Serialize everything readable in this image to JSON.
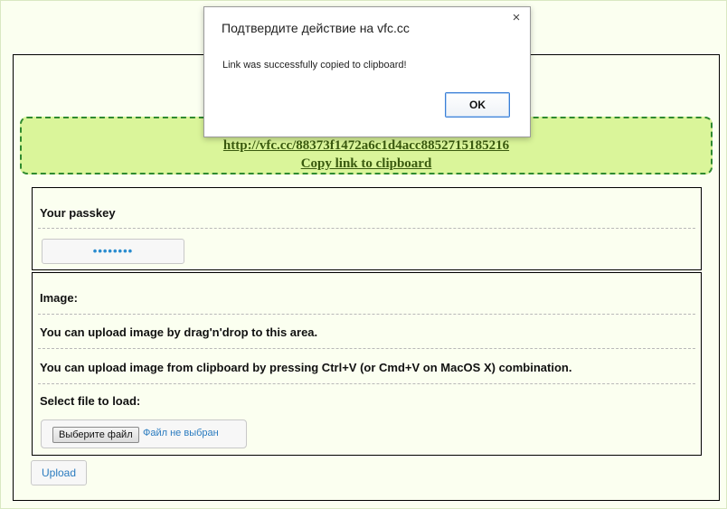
{
  "link_panel": {
    "url": "http://vfc.cc/88373f1472a6c1d4acc8852715185216",
    "copy_label": "Copy link to clipboard"
  },
  "passkey": {
    "label": "Your passkey",
    "value": "••••••••"
  },
  "image_section": {
    "label": "Image:",
    "drag_drop_text": "You can upload image by drag'n'drop to this area.",
    "clipboard_text": "You can upload image from clipboard by pressing Ctrl+V (or Cmd+V on MacOS X) combination.",
    "select_file_label": "Select file to load:",
    "choose_file_button": "Выберите файл",
    "file_status": "Файл не выбран"
  },
  "upload_button": "Upload",
  "dialog": {
    "title": "Подтвердите действие на vfc.cc",
    "close_glyph": "×",
    "message": "Link was successfully copied to clipboard!",
    "ok_label": "OK"
  },
  "colors": {
    "page_bg": "#fbfff0",
    "link_box_bg": "#daf59a",
    "link_box_border": "#2f8a2f",
    "link_text": "#3a5a0f",
    "accent_blue": "#2a7bbf"
  }
}
